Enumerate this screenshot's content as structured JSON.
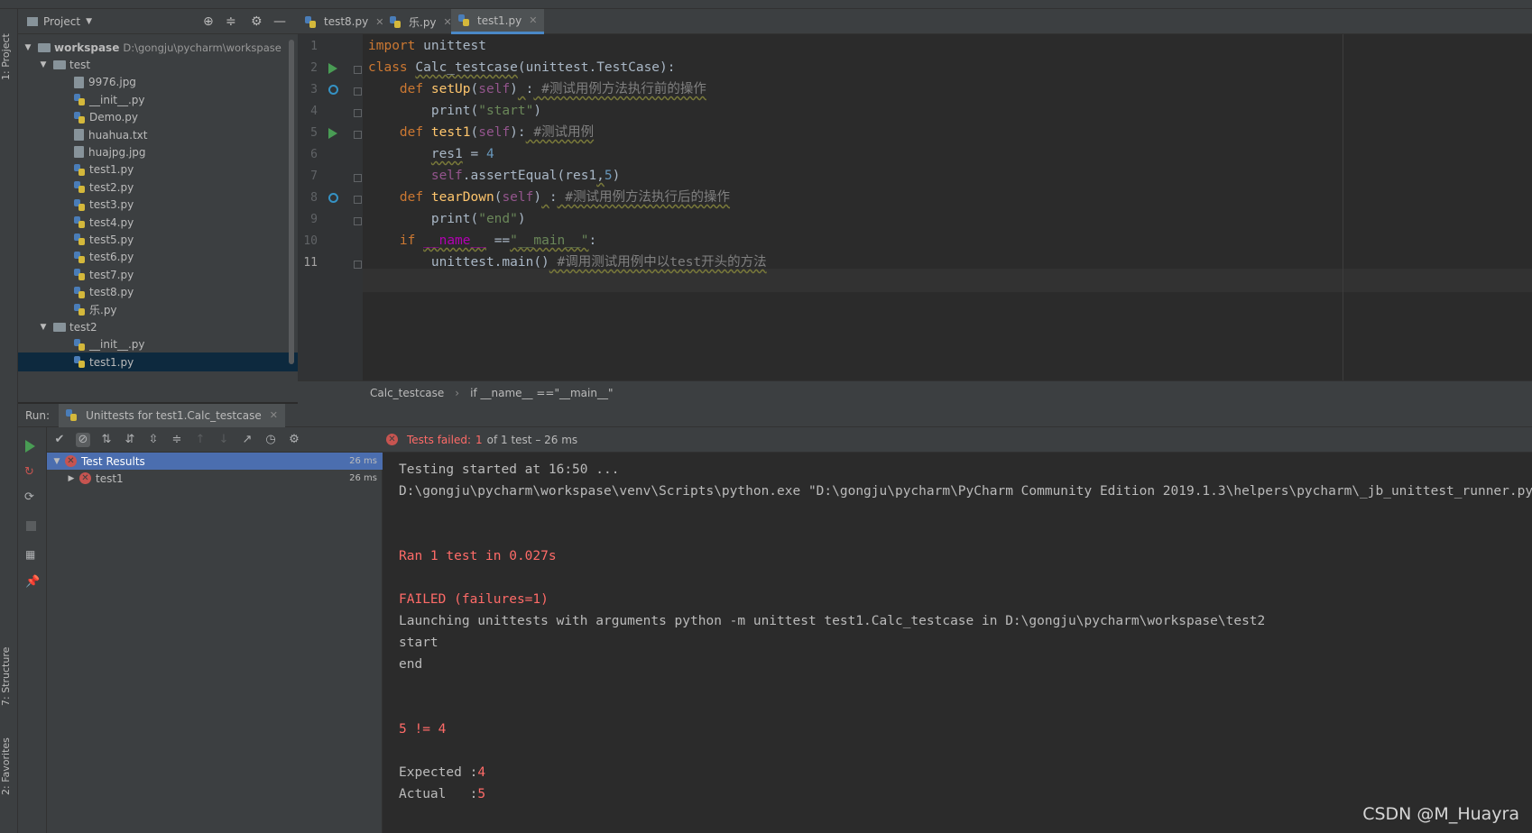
{
  "project": {
    "header_label": "Project",
    "tree": [
      {
        "label": "workspase",
        "path": "D:\\gongju\\pycharm\\workspase",
        "kind": "folder",
        "level": 0,
        "expanded": true
      },
      {
        "label": "test",
        "kind": "folder",
        "level": 1,
        "expanded": true
      },
      {
        "label": "9976.jpg",
        "kind": "file",
        "level": 2
      },
      {
        "label": "__init__.py",
        "kind": "py",
        "level": 2
      },
      {
        "label": "Demo.py",
        "kind": "py",
        "level": 2
      },
      {
        "label": "huahua.txt",
        "kind": "file",
        "level": 2
      },
      {
        "label": "huajpg.jpg",
        "kind": "file",
        "level": 2
      },
      {
        "label": "test1.py",
        "kind": "py",
        "level": 2
      },
      {
        "label": "test2.py",
        "kind": "py",
        "level": 2
      },
      {
        "label": "test3.py",
        "kind": "py",
        "level": 2
      },
      {
        "label": "test4.py",
        "kind": "py",
        "level": 2
      },
      {
        "label": "test5.py",
        "kind": "py",
        "level": 2
      },
      {
        "label": "test6.py",
        "kind": "py",
        "level": 2
      },
      {
        "label": "test7.py",
        "kind": "py",
        "level": 2
      },
      {
        "label": "test8.py",
        "kind": "py",
        "level": 2
      },
      {
        "label": "乐.py",
        "kind": "py",
        "level": 2
      },
      {
        "label": "test2",
        "kind": "folder",
        "level": 1,
        "expanded": true
      },
      {
        "label": "__init__.py",
        "kind": "py",
        "level": 2
      },
      {
        "label": "test1.py",
        "kind": "py",
        "level": 2,
        "selected": true
      }
    ]
  },
  "left_strip": {
    "project_tab": "1: Project",
    "structure_tab": "7: Structure",
    "favorites_tab": "2: Favorites"
  },
  "editor": {
    "tabs": [
      {
        "label": "test8.py",
        "active": false
      },
      {
        "label": "乐.py",
        "active": false
      },
      {
        "label": "test1.py",
        "active": true
      }
    ],
    "line_numbers": [
      "1",
      "2",
      "3",
      "4",
      "5",
      "6",
      "7",
      "8",
      "9",
      "10",
      "11"
    ],
    "breadcrumb": [
      "Calc_testcase",
      "if __name__ ==\"__main__\""
    ]
  },
  "run": {
    "label": "Run:",
    "tab_label": "Unittests for test1.Calc_testcase",
    "status": {
      "prefix": "Tests failed:",
      "count": "1",
      "suffix": "of 1 test – 26 ms"
    },
    "tree": [
      {
        "label": "Test Results",
        "time": "26 ms",
        "selected": true
      },
      {
        "label": "test1",
        "time": "26 ms",
        "selected": false
      }
    ],
    "console": [
      {
        "text": "Testing started at 16:50 ...",
        "color": "normal"
      },
      {
        "text": "D:\\gongju\\pycharm\\workspase\\venv\\Scripts\\python.exe \"D:\\gongju\\pycharm\\PyCharm Community Edition 2019.1.3\\helpers\\pycharm\\_jb_unittest_runner.py\"",
        "color": "normal"
      },
      {
        "text": "",
        "color": "normal"
      },
      {
        "text": "",
        "color": "normal"
      },
      {
        "text": "Ran 1 test in 0.027s",
        "color": "red"
      },
      {
        "text": "",
        "color": "normal"
      },
      {
        "text": "FAILED (failures=1)",
        "color": "red"
      },
      {
        "text": "Launching unittests with arguments python -m unittest test1.Calc_testcase in D:\\gongju\\pycharm\\workspase\\test2",
        "color": "normal"
      },
      {
        "text": "start",
        "color": "normal"
      },
      {
        "text": "end",
        "color": "normal"
      },
      {
        "text": "",
        "color": "normal"
      },
      {
        "text": "",
        "color": "normal"
      },
      {
        "text": "5 != 4",
        "color": "red"
      },
      {
        "text": "",
        "color": "normal"
      },
      {
        "text": "Expected :",
        "value": "4",
        "color": "mixed"
      },
      {
        "text": "Actual   :",
        "value": "5",
        "color": "mixed"
      }
    ]
  },
  "watermark": "CSDN @M_Huayra",
  "colors": {
    "keyword": "#cc7832",
    "function": "#ffc66d",
    "string": "#6a8759",
    "number": "#6897bb",
    "error": "#ff6b68",
    "selection": "#4b6eaf"
  }
}
